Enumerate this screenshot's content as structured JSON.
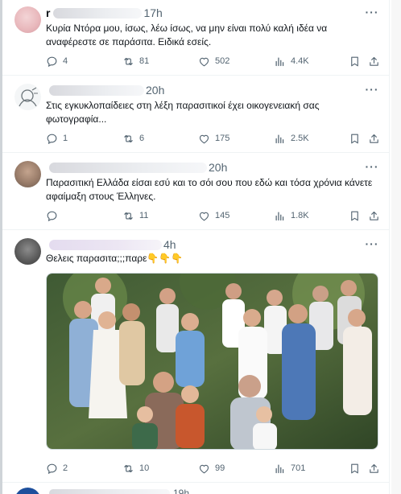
{
  "tweets": [
    {
      "name": "r",
      "time": "17h",
      "text": "Κυρία Ντόρα μου, ίσως, λέω ίσως, να μην είναι πολύ καλή ιδέα να αναφέρεστε σε παράσιτα. Ειδικά εσείς.",
      "replies": "4",
      "retweets": "81",
      "likes": "502",
      "views": "4.4K"
    },
    {
      "name": "",
      "time": "20h",
      "text": "Στις εγκυκλοπαίδειες στη λέξη παρασιτικοί έχει οικογενειακή σας φωτογραφία...",
      "replies": "1",
      "retweets": "6",
      "likes": "175",
      "views": "2.5K"
    },
    {
      "name": "",
      "time": "20h",
      "text": "Παρασιτική Ελλάδα είσαι εσύ και το σόι σου που εδώ και τόσα χρόνια κάνετε αφαίμαξη στους Έλληνες.",
      "replies": "",
      "retweets": "11",
      "likes": "145",
      "views": "1.8K"
    },
    {
      "name": "",
      "time": "4h",
      "text": "Θελεις παρασιτα;;;παρε👇👇👇",
      "replies": "2",
      "retweets": "10",
      "likes": "99",
      "views": "701"
    }
  ],
  "next_tweet": {
    "time": "19h"
  },
  "icons": {
    "reply": "reply-icon",
    "retweet": "retweet-icon",
    "like": "like-icon",
    "views": "views-icon",
    "bookmark": "bookmark-icon",
    "share": "share-icon",
    "more": "more-icon"
  },
  "colors": {
    "text": "#0f1419",
    "muted": "#536471",
    "divider": "#eff3f4",
    "link_blue": "#1d9bf0"
  }
}
